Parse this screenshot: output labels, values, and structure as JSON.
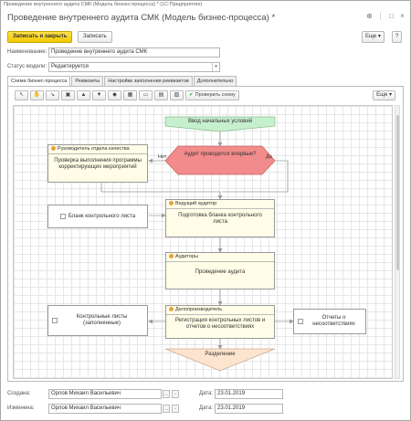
{
  "window": {
    "title": "Проведение внутреннего аудита СМК (Модель бизнес-процесса) * (1С:Предприятие)",
    "heading": "Проведение внутреннего аудита СМК (Модель бизнес-процесса) *"
  },
  "toolbar": {
    "save_close": "Записать и закрыть",
    "save": "Записать",
    "more": "Еще",
    "help": "?"
  },
  "form": {
    "name_label": "Наименование:",
    "name_value": "Проведение внутреннего аудита СМК",
    "status_label": "Статус модели:",
    "status_value": "Редактируется"
  },
  "tabs": [
    {
      "label": "Схема бизнес-процесса"
    },
    {
      "label": "Реквизиты"
    },
    {
      "label": "Настройки заполнения реквизитов"
    },
    {
      "label": "Дополнительно"
    }
  ],
  "scheme_toolbar": {
    "check_label": "Проверить схему",
    "more": "Еще"
  },
  "diagram": {
    "start": "Ввод начальных условий",
    "decision": "Аудит проводится впервые?",
    "no_label": "Нет",
    "yes_label": "Да",
    "quality_head_role": "Руководитель отдела качества",
    "quality_head_task": "Проверка выполнения программы корректирующих мероприятий",
    "blank_doc": "Бланк контрольного листа",
    "lead_auditor_role": "Ведущий аудитор",
    "lead_auditor_task": "Подготовка бланка контрольного листа",
    "auditors_role": "Аудиторы",
    "auditors_task": "Проведение аудита",
    "filled_doc": "Контрольные листы (заполненные)",
    "manager_role": "Делопроизводитель",
    "manager_task": "Регистрация контрольных листов и отчетов о несоответствиях",
    "reports_doc": "Отчеты о несоответствиях",
    "split": "Разделение"
  },
  "footer": {
    "created_label": "Создана:",
    "created_by": "Орлов Михаил Васильевич",
    "created_date_label": "Дата:",
    "created_date": "23.01.2019",
    "changed_label": "Изменена:",
    "changed_by": "Орлов Михаил Васильевич",
    "changed_date_label": "Дата:",
    "changed_date": "23.01.2019"
  },
  "colors": {
    "primary_button": "#f3c900",
    "start_node": "#c6efce",
    "decision_node": "#f28b8b",
    "task_node": "#fffde7",
    "split_node": "#fde4cf"
  }
}
